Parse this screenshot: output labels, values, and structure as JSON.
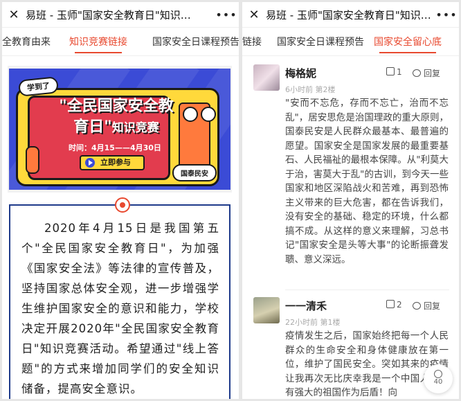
{
  "left": {
    "title": "易班 - 玉师\"国家安全教育日\"知识…",
    "tabs": [
      {
        "label": "全教育由来"
      },
      {
        "label": "知识竞赛链接"
      },
      {
        "label": "国家安全日课程预告"
      }
    ],
    "poster": {
      "badge": "学到了",
      "title_line1": "\"全民国家安全教",
      "title_line2": "育日\"",
      "title_line2_small": "知识竞赛",
      "time": "时间：4月15——4月30日",
      "button": "立即参与",
      "tag": "国泰民安"
    },
    "article_text": "2020年4月15日是我国第五个\"全民国家安全教育日\"，为加强《国家安全法》等法律的宣传普及，坚持国家总体安全观，进一步增强学生维护国家安全的意识和能力，学校决定开展2020年\"全民国家安全教育日\"知识竞赛活动。希望通过\"线上答题\"的方式来增加同学们的安全知识储备，提高安全意识。"
  },
  "right": {
    "title": "易班 - 玉师\"国家安全教育日\"知识…",
    "tabs": [
      {
        "label": "链接"
      },
      {
        "label": "国家安全日课程预告"
      },
      {
        "label": "国家安全留心底"
      }
    ],
    "comments": [
      {
        "name": "梅格妮",
        "likes": "1",
        "reply": "回复",
        "meta": "6小时前  第2楼",
        "text": "\"安而不忘危，存而不忘亡，治而不忘乱\"，居安思危是治国理政的重大原则，国泰民安是人民群众最基本、最普遍的愿望。国家安全是国家发展的最重要基石、人民福祉的最根本保障。从\"利莫大于治，害莫大于乱\"的古训，到今天一些国家和地区深陷战火和苦难，再到恐怖主义带来的巨大危害，都在告诉我们，没有安全的基础、稳定的环境，什么都搞不成。从这样的意义来理解，习总书记\"国家安全是头等大事\"的论断振聋发聩、意义深远。"
      },
      {
        "name": "一一清禾",
        "likes": "2",
        "reply": "回复",
        "meta": "22小时前  第1楼",
        "text": "疫情发生之后，国家始终把每一个人民群众的生命安全和身体健康放在第一位，维护了国民安全。突如其来的疫情让我再次无比庆幸我是一个中国人！我有强大的祖国作为后盾！向"
      }
    ],
    "float_count": "40"
  }
}
